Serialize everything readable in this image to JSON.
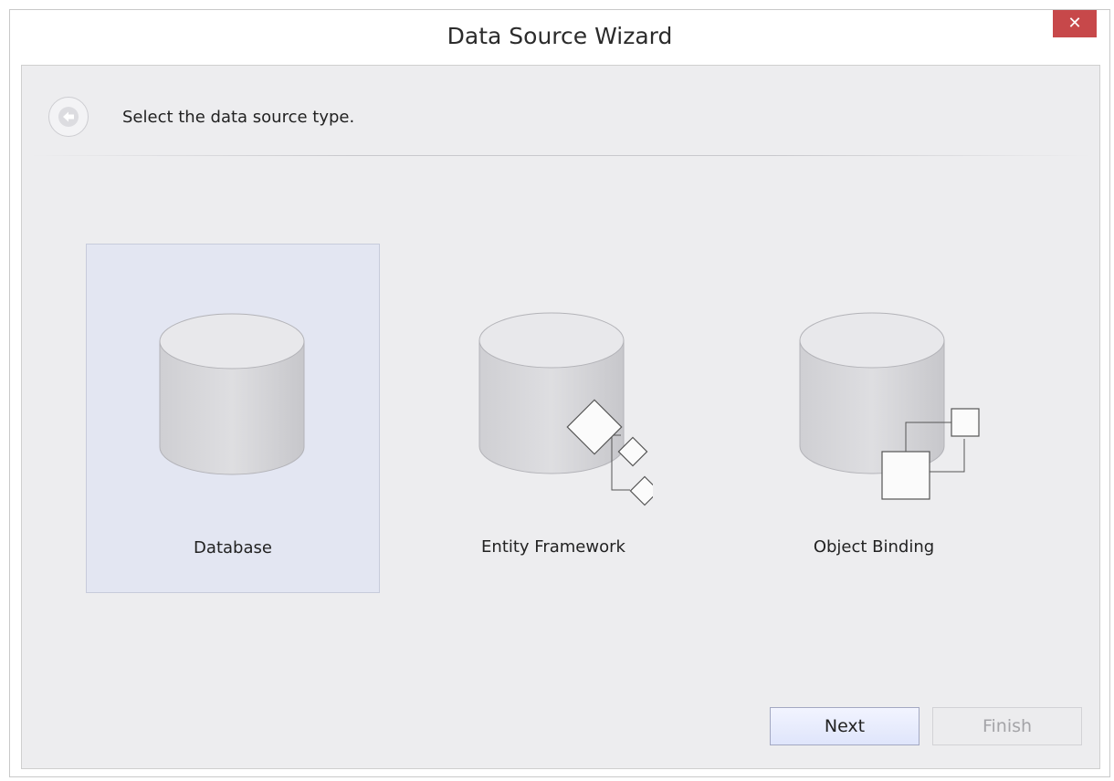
{
  "window": {
    "title": "Data Source Wizard",
    "close_glyph": "✕"
  },
  "header": {
    "subtitle": "Select the data source type."
  },
  "tiles": [
    {
      "label": "Database",
      "icon": "database-icon",
      "selected": true
    },
    {
      "label": "Entity Framework",
      "icon": "entity-framework-icon",
      "selected": false
    },
    {
      "label": "Object Binding",
      "icon": "object-binding-icon",
      "selected": false
    }
  ],
  "buttons": {
    "next": "Next",
    "finish": "Finish"
  },
  "colors": {
    "close": "#c7484a",
    "selected_tile": "#e3e6f2",
    "client_bg": "#ededef"
  }
}
